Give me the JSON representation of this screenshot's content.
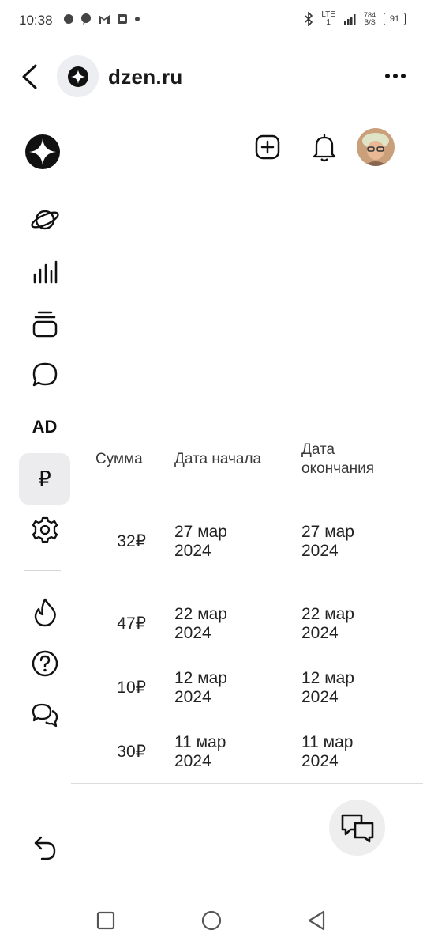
{
  "status_bar": {
    "time": "10:38",
    "network": "LTE",
    "sim": "1",
    "speed_value": "784",
    "speed_unit": "B/S",
    "battery": "91"
  },
  "browser": {
    "url": "dzen.ru"
  },
  "table": {
    "headers": {
      "amount": "Сумма",
      "start_date": "Дата начала",
      "end_date_line1": "Дата",
      "end_date_line2": "окончания"
    },
    "rows": [
      {
        "amount": "32₽",
        "start_1": "27 мар",
        "start_2": "2024",
        "end_1": "27 мар",
        "end_2": "2024"
      },
      {
        "amount": "47₽",
        "start_1": "22 мар",
        "start_2": "2024",
        "end_1": "22 мар",
        "end_2": "2024"
      },
      {
        "amount": "10₽",
        "start_1": "12 мар",
        "start_2": "2024",
        "end_1": "12 мар",
        "end_2": "2024"
      },
      {
        "amount": "30₽",
        "start_1": "11 мар",
        "start_2": "2024",
        "end_1": "11 мар",
        "end_2": "2024"
      }
    ]
  },
  "sidebar": {
    "ad_label": "AD",
    "ruble_label": "₽"
  },
  "icons": [
    "back-arrow-icon",
    "zen-logo-icon",
    "more-icon",
    "add-icon",
    "bell-icon",
    "avatar",
    "planet-icon",
    "stats-icon",
    "stack-icon",
    "chat-icon",
    "ruble-icon",
    "settings-icon",
    "fire-icon",
    "help-icon",
    "feedback-icon",
    "undo-icon",
    "messages-icon",
    "square-nav-icon",
    "circle-nav-icon",
    "triangle-nav-icon"
  ]
}
